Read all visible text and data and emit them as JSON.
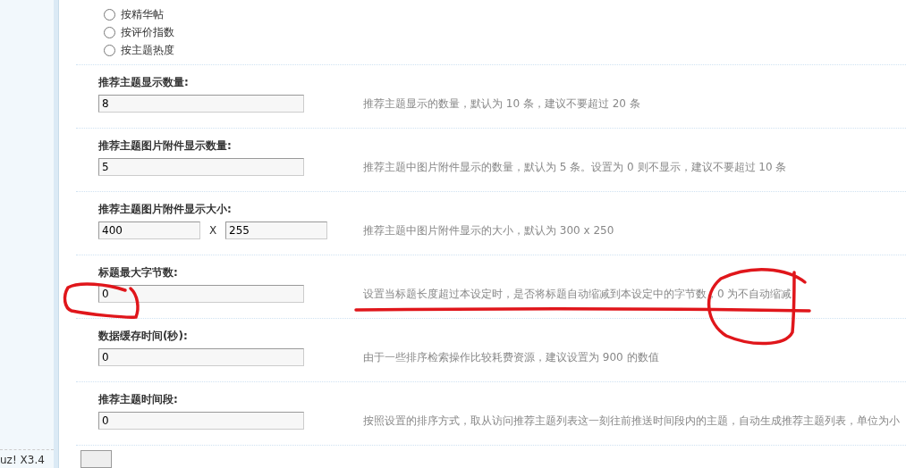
{
  "sort_options": [
    {
      "label": "按精华帖",
      "selected": false
    },
    {
      "label": "按评价指数",
      "selected": false
    },
    {
      "label": "按主题热度",
      "selected": false
    }
  ],
  "settings": [
    {
      "kind": "single",
      "label": "推荐主题显示数量:",
      "values": [
        "8"
      ],
      "description": "推荐主题显示的数量，默认为 10 条，建议不要超过 20 条"
    },
    {
      "kind": "single",
      "label": "推荐主题图片附件显示数量:",
      "values": [
        "5"
      ],
      "description": "推荐主题中图片附件显示的数量，默认为 5 条。设置为 0 则不显示，建议不要超过 10 条"
    },
    {
      "kind": "pair",
      "label": "推荐主题图片附件显示大小:",
      "values": [
        "400",
        "255"
      ],
      "separator": "X",
      "description": "推荐主题中图片附件显示的大小，默认为 300 x 250"
    },
    {
      "kind": "single",
      "label": "标题最大字节数:",
      "values": [
        "0"
      ],
      "description": "设置当标题长度超过本设定时，是否将标题自动缩减到本设定中的字节数，0 为不自动缩减"
    },
    {
      "kind": "single",
      "label": "数据缓存时间(秒):",
      "values": [
        "0"
      ],
      "description": "由于一些排序检索操作比较耗费资源，建议设置为 900 的数值"
    },
    {
      "kind": "single",
      "label": "推荐主题时间段:",
      "values": [
        "0"
      ],
      "description": "按照设置的排序方式，取从访问推荐主题列表这一刻往前推送时间段内的主题，自动生成推荐主题列表，单位为小"
    }
  ],
  "footer_version": "uz! X3.4"
}
